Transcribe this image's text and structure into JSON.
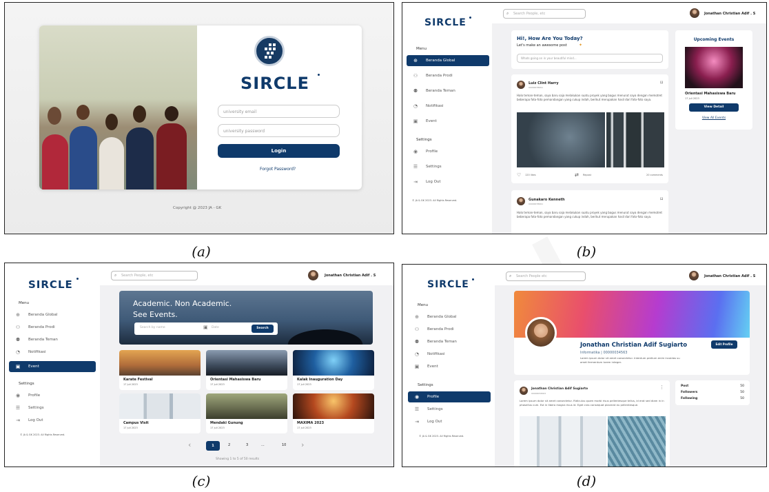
{
  "panels": {
    "a": {
      "caption": "(a)"
    },
    "b": {
      "caption": "(b)"
    },
    "c": {
      "caption": "(c)"
    },
    "d": {
      "caption": "(d)"
    }
  },
  "brand": "SIRCLE",
  "login": {
    "email_placeholder": "university email",
    "password_placeholder": "university password",
    "login_label": "Login",
    "forgot_label": "Forgot Password?",
    "copyright": "Copyright @ 2023 JA - GK"
  },
  "sidebar": {
    "menu_title": "Menu",
    "items": [
      {
        "label": "Beranda Global",
        "icon": "globe-icon"
      },
      {
        "label": "Beranda Prodi",
        "icon": "users-icon"
      },
      {
        "label": "Beranda Teman",
        "icon": "friends-icon"
      },
      {
        "label": "Notifikasi",
        "icon": "bell-icon"
      },
      {
        "label": "Event",
        "icon": "calendar-icon"
      }
    ],
    "settings_title": "Settings",
    "settings_items": [
      {
        "label": "Profile",
        "icon": "profile-icon"
      },
      {
        "label": "Settings",
        "icon": "sliders-icon"
      },
      {
        "label": "Log Out",
        "icon": "logout-icon"
      }
    ],
    "copyright": "© JA & GK 2023. All Rights Reserved."
  },
  "topbar": {
    "search_placeholder": "Search People, etc",
    "user_name": "Jonathan Christian Adif . S"
  },
  "feed": {
    "greeting": "Hi!, How Are You Today?",
    "sub": "Let's make an awesome post",
    "post_placeholder": "Whats going on in your beautiful mind...",
    "posts": [
      {
        "author": "Luiz Clint Harry",
        "nim": "00000078991",
        "text": "Halo teman-teman, saya baru saja melakukan suatu proyek yang bagus menurut saya dengan memotret beberapa foto-foto pemandangan yang cukup indah, berikut merupakan hasil dari foto-foto saya.",
        "likes": "120 likes",
        "repost": "Repost",
        "comments": "20 comments"
      },
      {
        "author": "Gunakaro Kenneth",
        "nim": "00000078991",
        "text": "Halo teman-teman, saya baru saja melakukan suatu proyek yang bagus menurut saya dengan memotret beberapa foto-foto pemandangan yang cukup indah, berikut merupakan hasil dari foto-foto saya."
      }
    ],
    "upcoming": {
      "title": "Upcoming Events",
      "event_name": "Orientasi Mahasiswa Baru",
      "date": "17 juli 2023",
      "view_detail": "View Detail",
      "view_all": "View All Events"
    }
  },
  "events": {
    "hero_line1": "Academic. Non Academic.",
    "hero_line2": "See Events.",
    "search_placeholder": "Search by name",
    "date_placeholder": "Date",
    "search_button": "Search",
    "cards": [
      {
        "title": "Karate Festival",
        "date": "17 juli 2023"
      },
      {
        "title": "Orientasi Mahasiswa Baru",
        "date": "17 juli 2023"
      },
      {
        "title": "Kalak Inauguration Day",
        "date": "17 juli 2023"
      },
      {
        "title": "Campus Visit",
        "date": "17 juli 2023"
      },
      {
        "title": "Mendaki Gunung",
        "date": "17 juli 2023"
      },
      {
        "title": "MAXIMA 2023",
        "date": "17 juli 2023"
      }
    ],
    "pagination": {
      "prev": "‹",
      "pages": [
        "1",
        "2",
        "3",
        "...",
        "10"
      ],
      "next": "›",
      "status": "Showing 1 to 5 of 50 results"
    }
  },
  "profile": {
    "search_placeholder": "Search People etc",
    "name": "Jonathan Christian Adif Sugiarto",
    "prodi": "Informatika | 00000034563",
    "bio": "Lorem ipsum dolor sit amet consectetur. Interdum pretium enim incoidas su amet fermentum lorem integer.",
    "edit_button": "Edit Profile",
    "post_author": "Jonathan Christian Adif Sugiarto",
    "post_nim": "00000034563",
    "post_text": "Lorem ipsum dolor sit amet consectetur. Ridiculus quam morbi risus pellentesque tellus, id erat sed diam in in phasellus cum. Est in libero magna risus id. Eget cras consequat placerat eu pellentesque.",
    "stats": [
      {
        "label": "Post",
        "value": "50"
      },
      {
        "label": "Followers",
        "value": "50"
      },
      {
        "label": "Following",
        "value": "50"
      }
    ]
  },
  "colors": {
    "primary": "#0f3a6b",
    "background": "#f1f1f3"
  }
}
